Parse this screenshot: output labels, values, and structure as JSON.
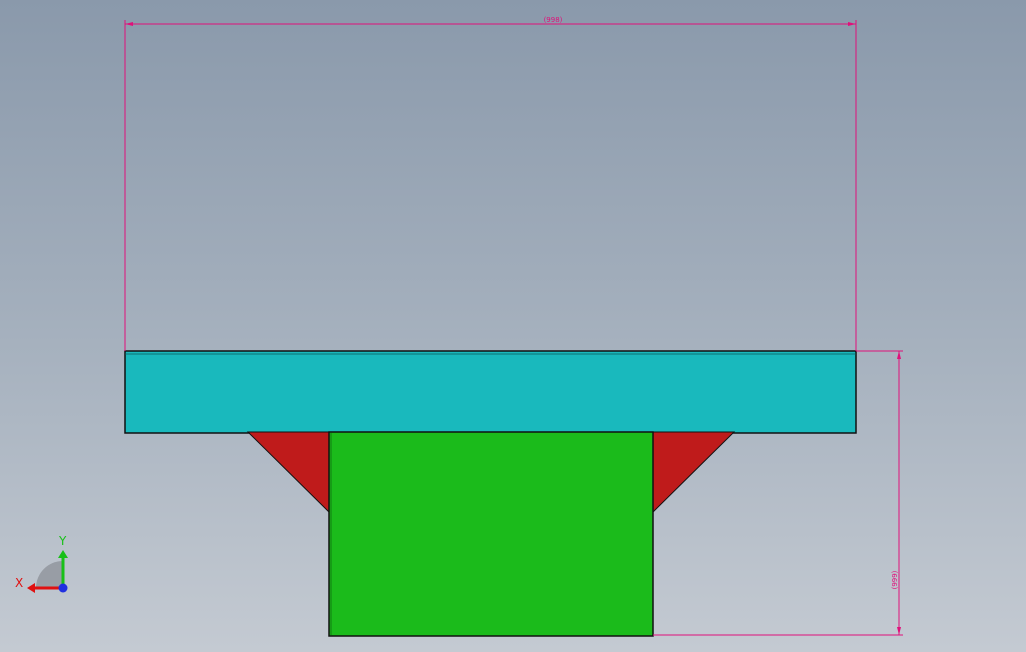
{
  "colors": {
    "flange": "#19b9bd",
    "web": "#1bbb1b",
    "gusset": "#bf1b1b",
    "dimension": "#e0107a",
    "axis_x": "#e01010",
    "axis_y": "#18c018",
    "axis_z": "#2030e0"
  },
  "dimensions": {
    "width_label": "(998)",
    "height_label": "(999)"
  },
  "triad": {
    "x_label": "X",
    "y_label": "Y"
  },
  "icons": {
    "triad": "coordinate-triad-icon"
  }
}
